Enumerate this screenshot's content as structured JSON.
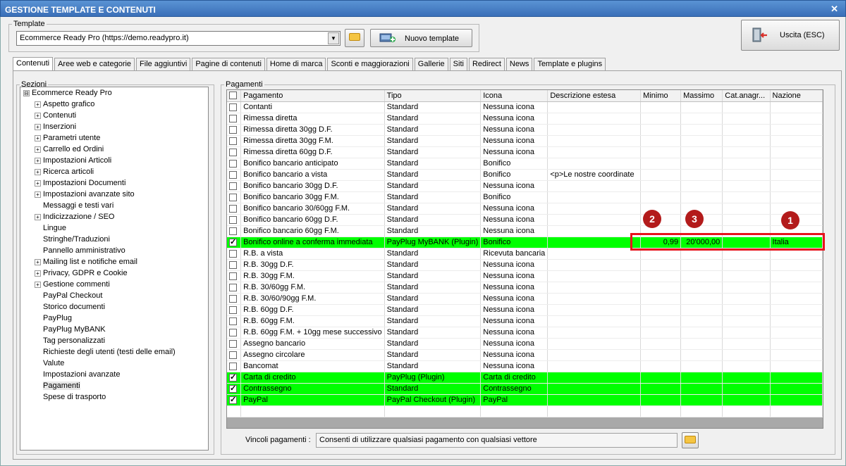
{
  "window": {
    "title": "GESTIONE TEMPLATE E CONTENUTI",
    "close_glyph": "✕"
  },
  "template_group": {
    "legend": "Template",
    "selected": "Ecommerce Ready Pro (https://demo.readypro.it)",
    "new_button": "Nuovo template"
  },
  "exit_button": "Uscita (ESC)",
  "tabs": [
    "Contenuti",
    "Aree web e categorie",
    "File aggiuntivi",
    "Pagine di contenuti",
    "Home di marca",
    "Sconti e maggiorazioni",
    "Gallerie",
    "Siti",
    "Redirect",
    "News",
    "Template e plugins"
  ],
  "sections": {
    "legend": "Sezioni",
    "items": [
      {
        "label": "Ecommerce Ready Pro",
        "level": 0,
        "expander": "⊟"
      },
      {
        "label": "Aspetto grafico",
        "level": 1,
        "expander": "+"
      },
      {
        "label": "Contenuti",
        "level": 1,
        "expander": "+"
      },
      {
        "label": "Inserzioni",
        "level": 1,
        "expander": "+"
      },
      {
        "label": "Parametri utente",
        "level": 1,
        "expander": "+"
      },
      {
        "label": "Carrello ed Ordini",
        "level": 1,
        "expander": "+"
      },
      {
        "label": "Impostazioni Articoli",
        "level": 1,
        "expander": "+"
      },
      {
        "label": "Ricerca articoli",
        "level": 1,
        "expander": "+"
      },
      {
        "label": "Impostazioni Documenti",
        "level": 1,
        "expander": "+"
      },
      {
        "label": "Impostazioni avanzate sito",
        "level": 1,
        "expander": "+"
      },
      {
        "label": "Messaggi e testi vari",
        "level": 1,
        "expander": ""
      },
      {
        "label": "Indicizzazione / SEO",
        "level": 1,
        "expander": "+"
      },
      {
        "label": "Lingue",
        "level": 1,
        "expander": ""
      },
      {
        "label": "Stringhe/Traduzioni",
        "level": 1,
        "expander": ""
      },
      {
        "label": "Pannello amministrativo",
        "level": 1,
        "expander": ""
      },
      {
        "label": "Mailing list e notifiche email",
        "level": 1,
        "expander": "+"
      },
      {
        "label": "Privacy, GDPR e Cookie",
        "level": 1,
        "expander": "+"
      },
      {
        "label": "Gestione commenti",
        "level": 1,
        "expander": "+"
      },
      {
        "label": "PayPal Checkout",
        "level": 1,
        "expander": ""
      },
      {
        "label": "Storico documenti",
        "level": 1,
        "expander": ""
      },
      {
        "label": "PayPlug",
        "level": 1,
        "expander": ""
      },
      {
        "label": "PayPlug MyBANK",
        "level": 1,
        "expander": ""
      },
      {
        "label": "Tag personalizzati",
        "level": 1,
        "expander": ""
      },
      {
        "label": "Richieste degli utenti (testi delle email)",
        "level": 1,
        "expander": ""
      },
      {
        "label": "Valute",
        "level": 1,
        "expander": ""
      },
      {
        "label": "Impostazioni avanzate",
        "level": 1,
        "expander": ""
      },
      {
        "label": "Pagamenti",
        "level": 1,
        "expander": "",
        "selected": true
      },
      {
        "label": "Spese di trasporto",
        "level": 1,
        "expander": ""
      }
    ]
  },
  "payments": {
    "legend": "Pagamenti",
    "columns": [
      "Pagamento",
      "Tipo",
      "Icona",
      "Descrizione estesa",
      "Minimo",
      "Massimo",
      "Cat.anagr...",
      "Nazione"
    ],
    "rows": [
      {
        "checked": false,
        "cells": [
          "Contanti",
          "Standard",
          "Nessuna icona",
          "",
          "",
          "",
          "",
          ""
        ]
      },
      {
        "checked": false,
        "cells": [
          "Rimessa diretta",
          "Standard",
          "Nessuna icona",
          "",
          "",
          "",
          "",
          ""
        ]
      },
      {
        "checked": false,
        "cells": [
          "Rimessa diretta 30gg D.F.",
          "Standard",
          "Nessuna icona",
          "",
          "",
          "",
          "",
          ""
        ]
      },
      {
        "checked": false,
        "cells": [
          "Rimessa diretta 30gg F.M.",
          "Standard",
          "Nessuna icona",
          "",
          "",
          "",
          "",
          ""
        ]
      },
      {
        "checked": false,
        "cells": [
          "Rimessa diretta 60gg D.F.",
          "Standard",
          "Nessuna icona",
          "",
          "",
          "",
          "",
          ""
        ]
      },
      {
        "checked": false,
        "cells": [
          "Bonifico bancario anticipato",
          "Standard",
          "Bonifico",
          "",
          "",
          "",
          "",
          ""
        ]
      },
      {
        "checked": false,
        "cells": [
          "Bonifico bancario a vista",
          "Standard",
          "Bonifico",
          "<p>Le nostre coordinate",
          "",
          "",
          "",
          ""
        ]
      },
      {
        "checked": false,
        "cells": [
          "Bonifico bancario 30gg D.F.",
          "Standard",
          "Nessuna icona",
          "",
          "",
          "",
          "",
          ""
        ]
      },
      {
        "checked": false,
        "cells": [
          "Bonifico bancario 30gg F.M.",
          "Standard",
          "Bonifico",
          "",
          "",
          "",
          "",
          ""
        ]
      },
      {
        "checked": false,
        "cells": [
          "Bonifico bancario 30/60gg F.M.",
          "Standard",
          "Nessuna icona",
          "",
          "",
          "",
          "",
          ""
        ]
      },
      {
        "checked": false,
        "cells": [
          "Bonifico bancario 60gg D.F.",
          "Standard",
          "Nessuna icona",
          "",
          "",
          "",
          "",
          ""
        ]
      },
      {
        "checked": false,
        "cells": [
          "Bonifico bancario 60gg F.M.",
          "Standard",
          "Nessuna icona",
          "",
          "",
          "",
          "",
          ""
        ]
      },
      {
        "checked": true,
        "green": true,
        "cells": [
          "Bonifico online a conferma immediata",
          "PayPlug MyBANK (Plugin)",
          "Bonifico",
          "",
          "0,99",
          "20'000,00",
          "",
          "Italia"
        ]
      },
      {
        "checked": false,
        "cells": [
          "R.B. a vista",
          "Standard",
          "Ricevuta bancaria",
          "",
          "",
          "",
          "",
          ""
        ]
      },
      {
        "checked": false,
        "cells": [
          "R.B. 30gg D.F.",
          "Standard",
          "Nessuna icona",
          "",
          "",
          "",
          "",
          ""
        ]
      },
      {
        "checked": false,
        "cells": [
          "R.B. 30gg F.M.",
          "Standard",
          "Nessuna icona",
          "",
          "",
          "",
          "",
          ""
        ]
      },
      {
        "checked": false,
        "cells": [
          "R.B. 30/60gg F.M.",
          "Standard",
          "Nessuna icona",
          "",
          "",
          "",
          "",
          ""
        ]
      },
      {
        "checked": false,
        "cells": [
          "R.B. 30/60/90gg F.M.",
          "Standard",
          "Nessuna icona",
          "",
          "",
          "",
          "",
          ""
        ]
      },
      {
        "checked": false,
        "cells": [
          "R.B. 60gg D.F.",
          "Standard",
          "Nessuna icona",
          "",
          "",
          "",
          "",
          ""
        ]
      },
      {
        "checked": false,
        "cells": [
          "R.B. 60gg F.M.",
          "Standard",
          "Nessuna icona",
          "",
          "",
          "",
          "",
          ""
        ]
      },
      {
        "checked": false,
        "cells": [
          "R.B. 60gg F.M. + 10gg mese successivo",
          "Standard",
          "Nessuna icona",
          "",
          "",
          "",
          "",
          ""
        ]
      },
      {
        "checked": false,
        "cells": [
          "Assegno bancario",
          "Standard",
          "Nessuna icona",
          "",
          "",
          "",
          "",
          ""
        ]
      },
      {
        "checked": false,
        "cells": [
          "Assegno circolare",
          "Standard",
          "Nessuna icona",
          "",
          "",
          "",
          "",
          ""
        ]
      },
      {
        "checked": false,
        "cells": [
          "Bancomat",
          "Standard",
          "Nessuna icona",
          "",
          "",
          "",
          "",
          ""
        ]
      },
      {
        "checked": true,
        "green": true,
        "cells": [
          "Carta di credito",
          "PayPlug (Plugin)",
          "Carta di credito",
          "",
          "",
          "",
          "",
          ""
        ]
      },
      {
        "checked": true,
        "green": true,
        "cells": [
          "Contrassegno",
          "Standard",
          "Contrassegno",
          "",
          "",
          "",
          "",
          ""
        ]
      },
      {
        "checked": true,
        "green": true,
        "cells": [
          "PayPal",
          "PayPal Checkout (Plugin)",
          "PayPal",
          "",
          "",
          "",
          "",
          ""
        ]
      }
    ]
  },
  "markers": [
    "1",
    "2",
    "3"
  ],
  "constraints": {
    "label": "Vincoli pagamenti :",
    "value": "Consenti di utilizzare qualsiasi pagamento con qualsiasi vettore"
  },
  "colors": {
    "highlight_row": "#00ff00",
    "annotation_box": "#e8131c",
    "marker": "#b31b1b",
    "title_bar": "#3a6fb8"
  },
  "icons": {
    "close": "close-icon",
    "folder": "folder-icon",
    "new_template": "new-template-icon",
    "exit": "exit-door-icon"
  }
}
